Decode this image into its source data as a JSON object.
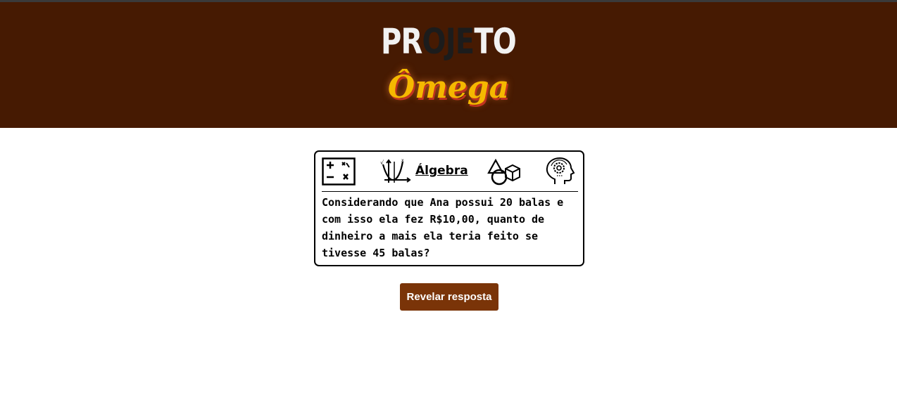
{
  "header": {
    "logo_title_parts": [
      "PR",
      "OJE",
      "TO"
    ],
    "logo_subtitle": "Ômega"
  },
  "card": {
    "icons": [
      "arithmetic-operators-icon",
      "function-graph-icon",
      "geometry-shapes-icon",
      "head-gear-icon"
    ],
    "topic_label": "Álgebra",
    "question": "Considerando que Ana possui 20 balas e com isso ela fez R$10,00, quanto de dinheiro a mais ela teria feito se tivesse 45 balas?"
  },
  "actions": {
    "reveal_label": "Revelar resposta"
  },
  "colors": {
    "header_bg": "#461a02",
    "button_bg": "#7a3408",
    "logo_yellow": "#f5b800"
  }
}
